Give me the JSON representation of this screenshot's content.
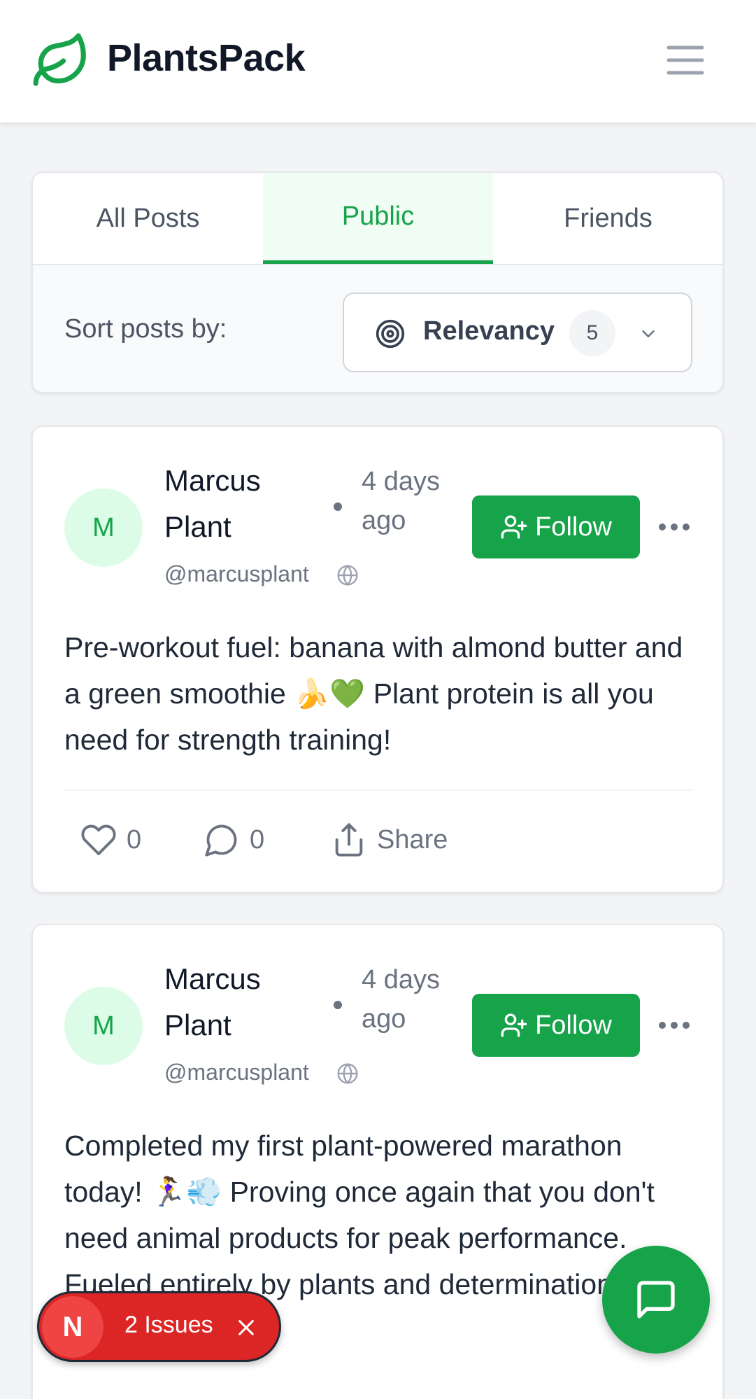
{
  "header": {
    "brand": "PlantsPack",
    "logo_icon": "leaf-icon",
    "menu_icon": "hamburger-menu-icon"
  },
  "feed_tabs": [
    {
      "label": "All Posts",
      "active": false
    },
    {
      "label": "Public",
      "active": true
    },
    {
      "label": "Friends",
      "active": false
    }
  ],
  "sort": {
    "label": "Sort posts by:",
    "value": "Relevancy",
    "count": "5",
    "icon": "target-icon"
  },
  "posts": [
    {
      "avatar_initial": "M",
      "author": "Marcus Plant",
      "handle": "@marcusplant",
      "visibility_icon": "globe-icon",
      "time": "4 days ago",
      "follow_label": "Follow",
      "content": "Pre-workout fuel: banana with almond butter and a green smoothie 🍌💚 Plant protein is all you need for strength training!",
      "likes": "0",
      "comments": "0",
      "share_label": "Share"
    },
    {
      "avatar_initial": "M",
      "author": "Marcus Plant",
      "handle": "@marcusplant",
      "visibility_icon": "globe-icon",
      "time": "4 days ago",
      "follow_label": "Follow",
      "content": "Completed my first plant-powered marathon today! 🏃‍♀️💨 Proving once again that you don't need animal products for peak performance. Fueled entirely by plants and determination!"
    }
  ],
  "issues": {
    "badge": "N",
    "label": "2 Issues"
  },
  "colors": {
    "brand_green": "#16a34a",
    "issues_red": "#dc2626"
  }
}
